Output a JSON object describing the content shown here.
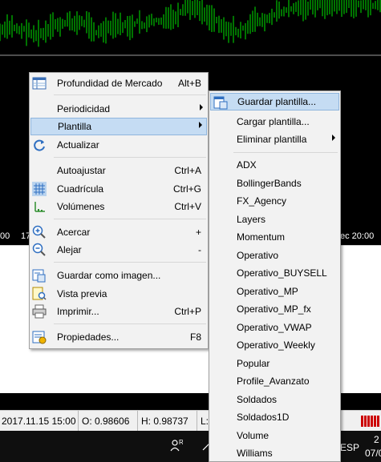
{
  "chart": {
    "axis_left_ticks": [
      "00",
      "17"
    ],
    "axis_right_tick": "ec 20:00"
  },
  "statusbar": {
    "datetime": "2017.11.15 15:00",
    "open": "O: 0.98606",
    "high": "H: 0.98737",
    "low": "L:"
  },
  "taskbar": {
    "lang": "ESP",
    "clock_top": "2",
    "clock_bottom": "07/0"
  },
  "context_menu": {
    "items": [
      {
        "label": "Profundidad de Mercado",
        "shortcut": "Alt+B",
        "icon": "market-depth-icon"
      },
      {
        "label": "Periodicidad",
        "shortcut": "",
        "icon": ""
      },
      {
        "label": "Plantilla",
        "shortcut": "",
        "icon": ""
      },
      {
        "label": "Actualizar",
        "shortcut": "",
        "icon": "refresh-icon"
      },
      {
        "label": "Autoajustar",
        "shortcut": "Ctrl+A",
        "icon": ""
      },
      {
        "label": "Cuadrícula",
        "shortcut": "Ctrl+G",
        "icon": "grid-icon"
      },
      {
        "label": "Volúmenes",
        "shortcut": "Ctrl+V",
        "icon": "volumes-icon"
      },
      {
        "label": "Acercar",
        "shortcut": "+",
        "icon": "zoom-in-icon"
      },
      {
        "label": "Alejar",
        "shortcut": "-",
        "icon": "zoom-out-icon"
      },
      {
        "label": "Guardar como imagen...",
        "shortcut": "",
        "icon": "save-image-icon"
      },
      {
        "label": "Vista previa",
        "shortcut": "",
        "icon": "print-preview-icon"
      },
      {
        "label": "Imprimir...",
        "shortcut": "Ctrl+P",
        "icon": "print-icon"
      },
      {
        "label": "Propiedades...",
        "shortcut": "F8",
        "icon": "properties-icon"
      }
    ]
  },
  "template_submenu": {
    "actions": [
      {
        "label": "Guardar plantilla...",
        "icon": "save-template-icon"
      },
      {
        "label": "Cargar plantilla..."
      },
      {
        "label": "Eliminar plantilla"
      }
    ],
    "templates": [
      "ADX",
      "BollingerBands",
      "FX_Agency",
      "Layers",
      "Momentum",
      "Operativo",
      "Operativo_BUYSELL",
      "Operativo_MP",
      "Operativo_MP_fx",
      "Operativo_VWAP",
      "Operativo_Weekly",
      "Popular",
      "Profile_Avanzato",
      "Soldados",
      "Soldados1D",
      "Volume",
      "Williams"
    ]
  },
  "colors": {
    "chart_bg": "#000000",
    "candles": "#00e600",
    "highlight": "#c5dcf3"
  }
}
